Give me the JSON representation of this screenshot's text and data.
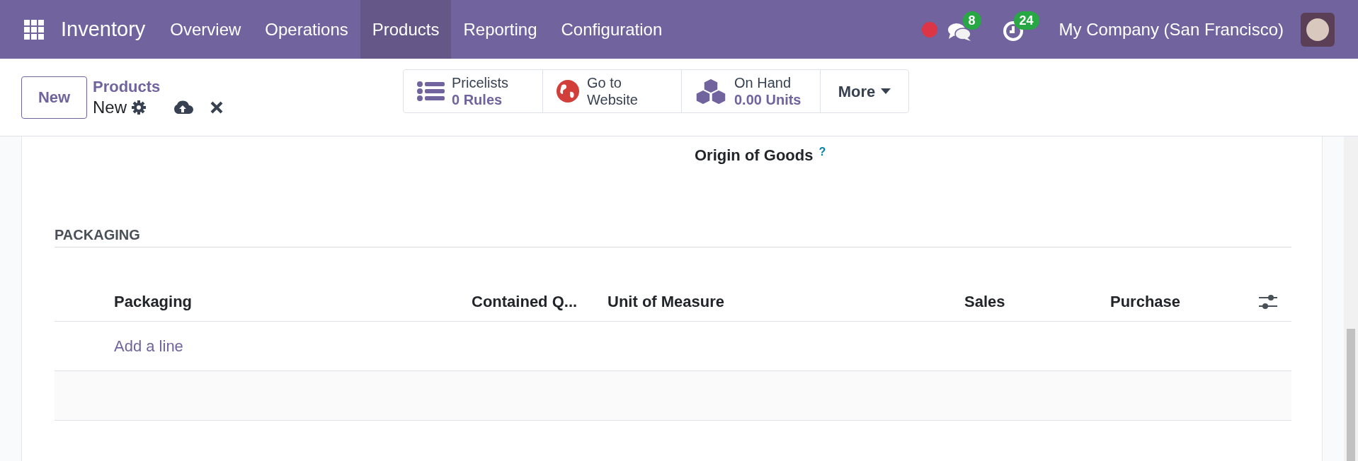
{
  "navbar": {
    "app_name": "Inventory",
    "menu": [
      {
        "label": "Overview",
        "selected": false
      },
      {
        "label": "Operations",
        "selected": false
      },
      {
        "label": "Products",
        "selected": true
      },
      {
        "label": "Reporting",
        "selected": false
      },
      {
        "label": "Configuration",
        "selected": false
      }
    ],
    "messages_count": "8",
    "activities_count": "24",
    "company": "My Company (San Francisco)"
  },
  "control_panel": {
    "new_button": "New",
    "breadcrumb": "Products",
    "record": "New",
    "stat_buttons": [
      {
        "kind": "list",
        "label": "Pricelists",
        "value": "0",
        "unit": "Rules"
      },
      {
        "kind": "globe",
        "label": "Go to",
        "label2": "Website"
      },
      {
        "kind": "cubes",
        "label": "On Hand",
        "value": "0.00",
        "unit": "Units"
      }
    ],
    "more_button": "More"
  },
  "form": {
    "field_label": "Origin of Goods",
    "help_mark": "?",
    "section": "PACKAGING",
    "table": {
      "columns": [
        "Packaging",
        "Contained Q...",
        "Unit of Measure",
        "Sales",
        "Purchase"
      ],
      "add_line": "Add a line"
    }
  }
}
